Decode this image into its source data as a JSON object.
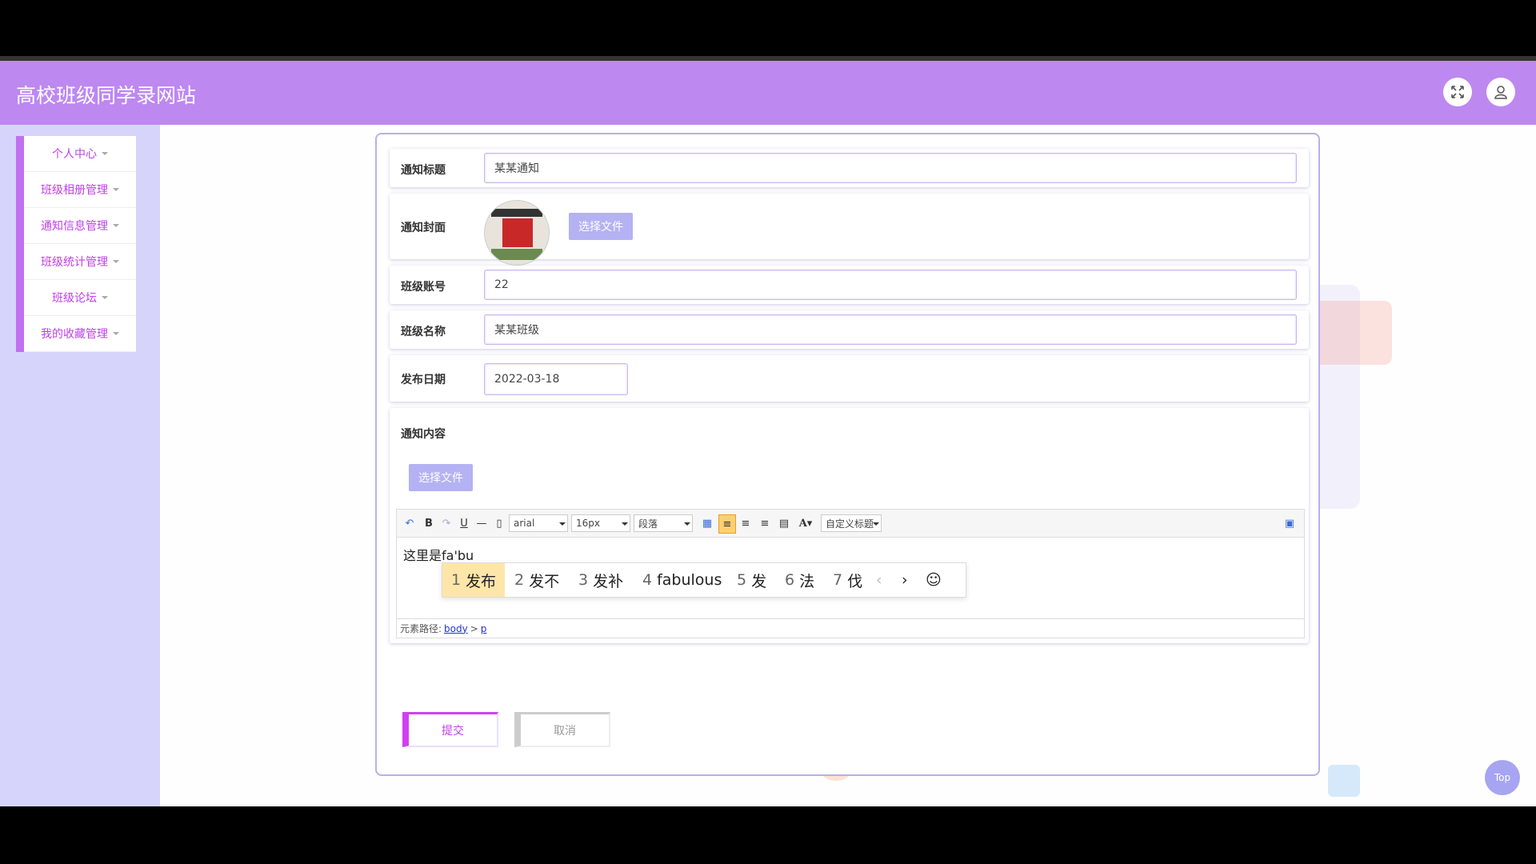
{
  "header": {
    "title": "高校班级同学录网站"
  },
  "sidebar": {
    "items": [
      {
        "label": "个人中心"
      },
      {
        "label": "班级相册管理"
      },
      {
        "label": "通知信息管理"
      },
      {
        "label": "班级统计管理"
      },
      {
        "label": "班级论坛"
      },
      {
        "label": "我的收藏管理"
      }
    ]
  },
  "form": {
    "title": {
      "label": "通知标题",
      "value": "某某通知"
    },
    "cover": {
      "label": "通知封面",
      "button": "选择文件"
    },
    "account": {
      "label": "班级账号",
      "value": "22"
    },
    "classname": {
      "label": "班级名称",
      "value": "某某班级"
    },
    "date": {
      "label": "发布日期",
      "value": "2022-03-18"
    },
    "content": {
      "label": "通知内容",
      "button": "选择文件",
      "toolbar": {
        "font": "arial",
        "size": "16px",
        "paragraph": "段落",
        "custom_title": "自定义标题"
      },
      "text": "这里是fa'bu",
      "path_label": "元素路径:",
      "path_body": "body",
      "path_sep": ">",
      "path_p": "p"
    },
    "submit": "提交",
    "cancel": "取消"
  },
  "ime": {
    "candidates": [
      {
        "num": "1",
        "text": "发布"
      },
      {
        "num": "2",
        "text": "发不"
      },
      {
        "num": "3",
        "text": "发补"
      },
      {
        "num": "4",
        "text": "fabulous"
      },
      {
        "num": "5",
        "text": "发"
      },
      {
        "num": "6",
        "text": "法"
      },
      {
        "num": "7",
        "text": "伐"
      }
    ],
    "prev": "‹",
    "next": "›",
    "emoji": "☺"
  },
  "top_button": "Top",
  "colors": {
    "header": "#bd88f0",
    "sidebar_bg": "#d7d4fc",
    "accent": "#c040e8",
    "file_button": "#b4b2f2"
  }
}
